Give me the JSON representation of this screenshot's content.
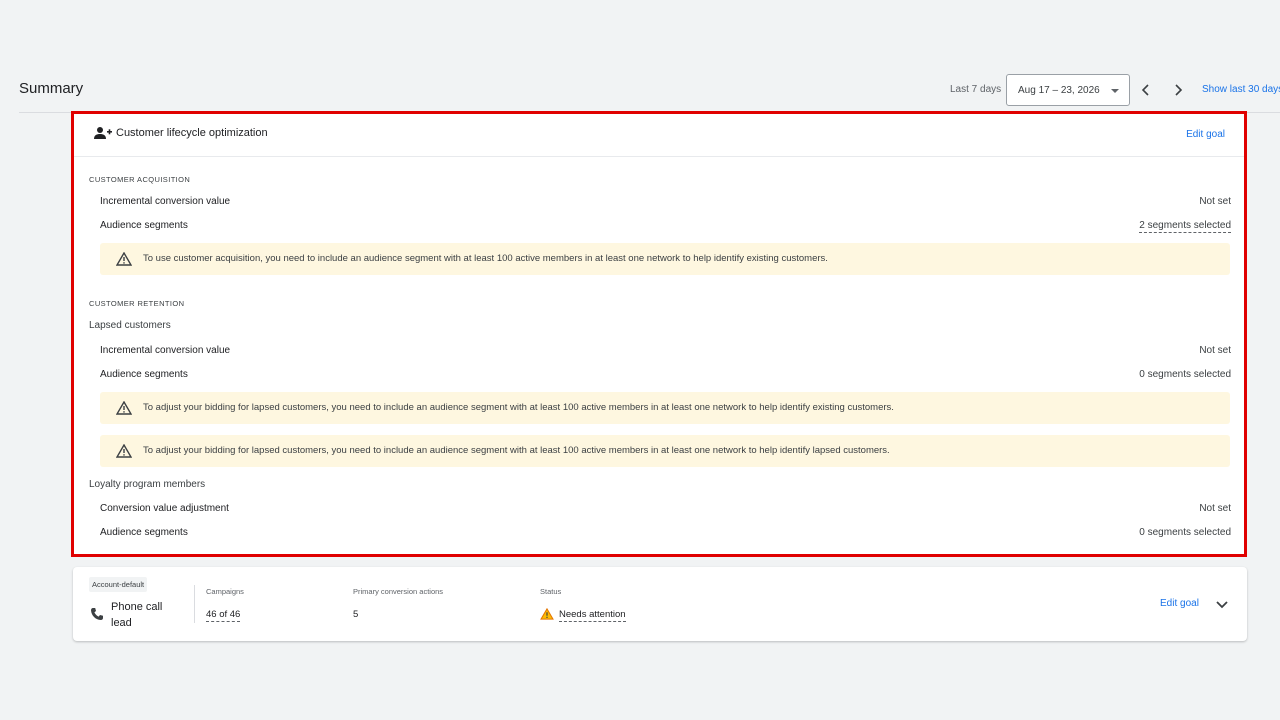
{
  "header": {
    "title": "Summary",
    "date_label": "Last 7 days",
    "date_range": "Aug 17 – 23, 2026",
    "show_last": "Show last 30 days"
  },
  "goal_card": {
    "icon": "person-add-icon",
    "title": "Customer lifecycle optimization",
    "edit_label": "Edit goal",
    "acquisition": {
      "section_label": "CUSTOMER ACQUISITION",
      "rows": [
        {
          "label": "Incremental conversion value",
          "value": "Not set"
        },
        {
          "label": "Audience segments",
          "value": "2 segments selected"
        }
      ],
      "warning": "To use customer acquisition, you need to include an audience segment with at least 100 active members in at least one network to help identify existing customers."
    },
    "retention": {
      "section_label": "CUSTOMER RETENTION",
      "lapsed": {
        "label": "Lapsed customers",
        "rows": [
          {
            "label": "Incremental conversion value",
            "value": "Not set"
          },
          {
            "label": "Audience segments",
            "value": "0 segments selected"
          }
        ],
        "warnings": [
          "To adjust your bidding for lapsed customers, you need to include an audience segment with at least 100 active members in at least one network to help identify existing customers.",
          "To adjust your bidding for lapsed customers, you need to include an audience segment with at least 100 active members in at least one network to help identify lapsed customers."
        ]
      },
      "loyalty": {
        "label": "Loyalty program members",
        "rows": [
          {
            "label": "Conversion value adjustment",
            "value": "Not set"
          },
          {
            "label": "Audience segments",
            "value": "0 segments selected"
          }
        ]
      }
    }
  },
  "lead_card": {
    "chip": "Account-default",
    "icon": "phone-icon",
    "name": "Phone call lead",
    "campaigns_label": "Campaigns",
    "campaigns_value": "46 of 46",
    "primary_label": "Primary conversion actions",
    "primary_value": "5",
    "status_label": "Status",
    "status_value": "Needs attention",
    "edit_label": "Edit goal"
  },
  "colors": {
    "accent": "#1a73e8",
    "warning_bg": "#fef7e0",
    "warning_icon": "#e37400",
    "highlight": "#e00000"
  }
}
